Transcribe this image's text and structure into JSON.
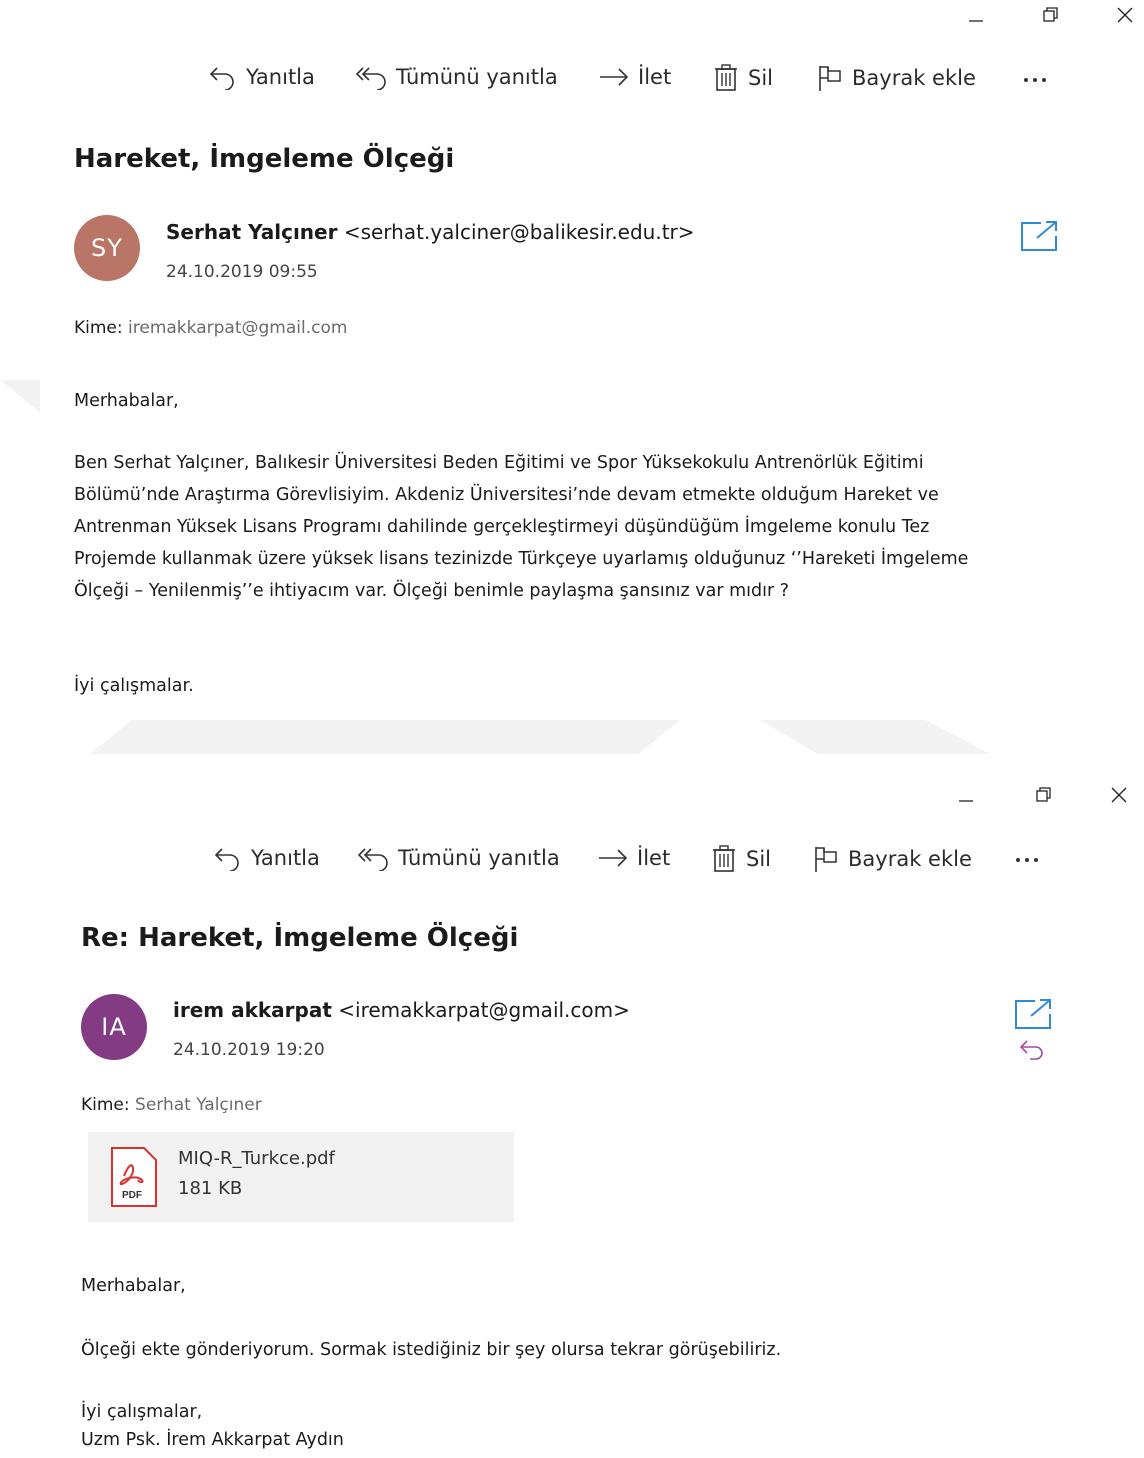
{
  "accent_color": "#2f8ad9",
  "toolbar": {
    "reply_label": "Yanıtla",
    "reply_all_label": "Tümünü yanıtla",
    "forward_label": "İlet",
    "delete_label": "Sil",
    "flag_label": "Bayrak ekle"
  },
  "messages": [
    {
      "subject": "Hareket, İmgeleme Ölçeği",
      "avatar_initials": "SY",
      "avatar_color": "#b97566",
      "sender_name": "Serhat Yalçıner",
      "sender_email": "<serhat.yalciner@balikesir.edu.tr>",
      "date": "24.10.2019 09:55",
      "to_label": "Kime:",
      "to_value": "iremakkarpat@gmail.com",
      "greeting": "Merhabalar,",
      "body_lines": [
        "Ben Serhat Yalçıner, Balıkesir Üniversitesi Beden Eğitimi ve Spor  Yüksekokulu Antrenörlük Eğitimi",
        "Bölümü’nde Araştırma Görevlisiyim. Akdeniz Üniversitesi’nde devam etmekte olduğum Hareket ve",
        "Antrenman Yüksek Lisans Programı dahilinde gerçekleştirmeyi düşündüğüm İmgeleme konulu Tez",
        "Projemde kullanmak üzere yüksek lisans tezinizde Türkçeye uyarlamış olduğunuz ‘’Hareketi İmgeleme",
        "Ölçeği – Yenilenmiş’’e ihtiyacım var. Ölçeği benimle paylaşma şansınız var mıdır ?"
      ],
      "closing": "İyi çalışmalar."
    },
    {
      "subject": "Re: Hareket, İmgeleme Ölçeği",
      "avatar_initials": "IA",
      "avatar_color": "#833b84",
      "sender_name": "irem akkarpat",
      "sender_email": "<iremakkarpat@gmail.com>",
      "date": "24.10.2019 19:20",
      "to_label": "Kime:",
      "to_value": "Serhat Yalçıner",
      "attachment": {
        "file_name": "MIQ-R_Turkce.pdf",
        "file_size": "181 KB",
        "file_type": "PDF"
      },
      "greeting": "Merhabalar,",
      "body_lines": [
        "Ölçeği ekte gönderiyorum. Sormak istediğiniz bir şey olursa tekrar görüşebiliriz."
      ],
      "closing_lines": [
        "İyi çalışmalar,",
        "Uzm Psk. İrem Akkarpat Aydın"
      ]
    }
  ]
}
